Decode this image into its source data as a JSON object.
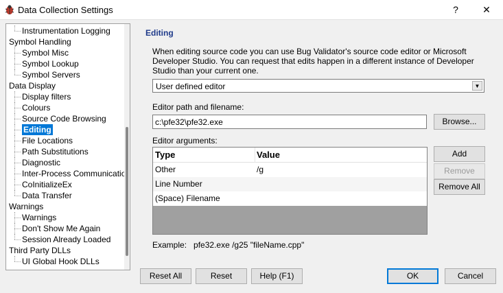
{
  "window": {
    "title": "Data Collection Settings",
    "help_label": "?",
    "close_label": "✕"
  },
  "tree": {
    "items": [
      {
        "label": "Instrumentation Logging",
        "level": 1
      },
      {
        "label": "Symbol Handling",
        "level": 0
      },
      {
        "label": "Symbol Misc",
        "level": 1
      },
      {
        "label": "Symbol Lookup",
        "level": 1
      },
      {
        "label": "Symbol Servers",
        "level": 1
      },
      {
        "label": "Data Display",
        "level": 0
      },
      {
        "label": "Display filters",
        "level": 1
      },
      {
        "label": "Colours",
        "level": 1
      },
      {
        "label": "Source Code Browsing",
        "level": 1
      },
      {
        "label": "Editing",
        "level": 1,
        "selected": true
      },
      {
        "label": "File Locations",
        "level": 1
      },
      {
        "label": "Path Substitutions",
        "level": 1
      },
      {
        "label": "Diagnostic",
        "level": 1
      },
      {
        "label": "Inter-Process Communication",
        "level": 1
      },
      {
        "label": "CoInitializeEx",
        "level": 1
      },
      {
        "label": "Data Transfer",
        "level": 1
      },
      {
        "label": "Warnings",
        "level": 0
      },
      {
        "label": "Warnings",
        "level": 1
      },
      {
        "label": "Don't Show Me Again",
        "level": 1
      },
      {
        "label": "Session Already Loaded",
        "level": 1
      },
      {
        "label": "Third Party DLLs",
        "level": 0
      },
      {
        "label": "UI Global Hook DLLs",
        "level": 1
      }
    ]
  },
  "panel": {
    "title": "Editing",
    "description": "When editing source code you can use Bug Validator's source code editor or Microsoft Developer Studio. You can request that edits happen in a different instance of Developer Studio than your current one.",
    "editor_select": "User defined editor",
    "editor_path_label": "Editor path and filename:",
    "editor_path_value": "c:\\pfe32\\pfe32.exe",
    "browse_label": "Browse...",
    "editor_args_label": "Editor arguments:",
    "table": {
      "columns": [
        "Type",
        "Value"
      ],
      "rows": [
        {
          "type": "Other",
          "value": "/g"
        },
        {
          "type": "Line Number",
          "value": ""
        },
        {
          "type": "(Space) Filename",
          "value": ""
        }
      ]
    },
    "add_label": "Add",
    "remove_label": "Remove",
    "remove_all_label": "Remove All",
    "example_label": "Example:",
    "example_value": "pfe32.exe /g25 \"fileName.cpp\""
  },
  "footer": {
    "reset_all": "Reset All",
    "reset": "Reset",
    "help": "Help (F1)",
    "ok": "OK",
    "cancel": "Cancel"
  }
}
